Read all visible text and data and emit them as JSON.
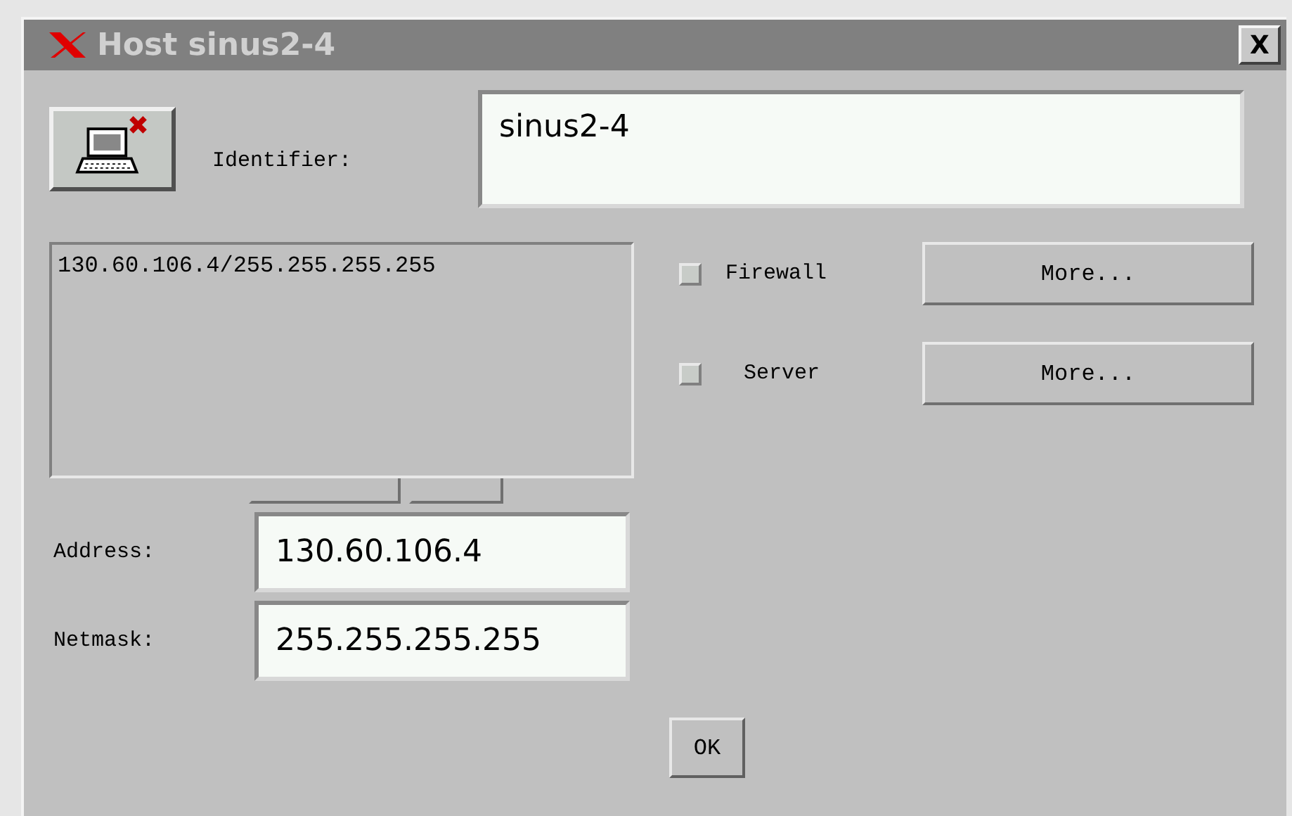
{
  "window": {
    "title": "Host sinus2-4",
    "close": "X"
  },
  "identifier": {
    "label": "Identifier:",
    "value": "sinus2-4"
  },
  "list": {
    "items": [
      "130.60.106.4/255.255.255.255"
    ]
  },
  "options": [
    {
      "label": "Firewall",
      "checked": false,
      "button": "More..."
    },
    {
      "label": "Server",
      "checked": false,
      "button": "More..."
    }
  ],
  "address": {
    "label": "Address:",
    "value": "130.60.106.4"
  },
  "netmask": {
    "label": "Netmask:",
    "value": "255.255.255.255"
  },
  "buttons": [
    "OK"
  ]
}
